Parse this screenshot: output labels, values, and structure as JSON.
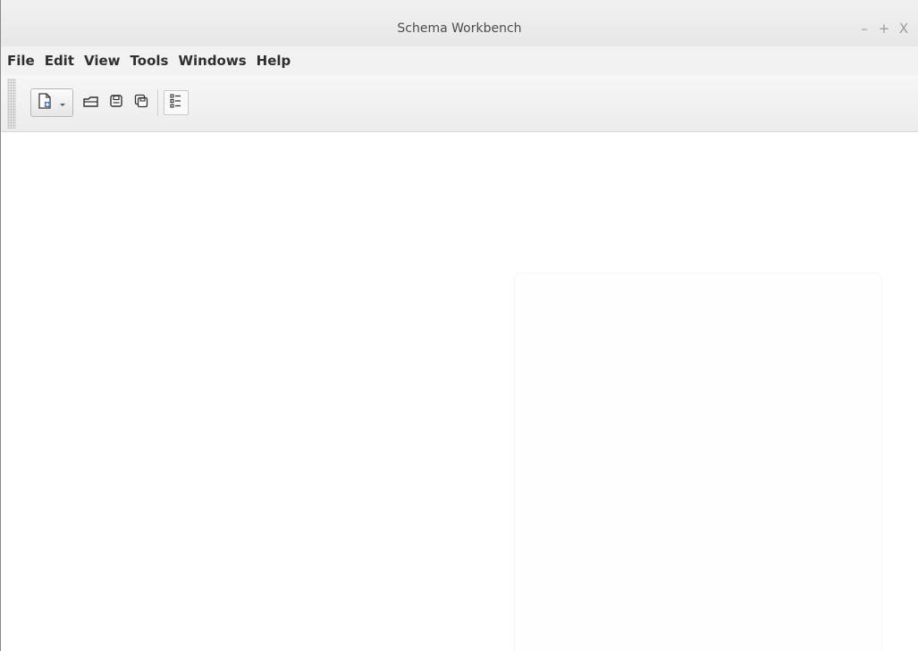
{
  "window": {
    "title": "Schema Workbench",
    "controls": {
      "minimize": "–",
      "maximize": "+",
      "close": "X"
    }
  },
  "menubar": {
    "items": [
      {
        "label": "File"
      },
      {
        "label": "Edit"
      },
      {
        "label": "View"
      },
      {
        "label": "Tools"
      },
      {
        "label": "Windows"
      },
      {
        "label": "Help"
      }
    ]
  },
  "toolbar": {
    "buttons": [
      {
        "icon": "new-file-icon"
      },
      {
        "icon": "dropdown-arrow-icon"
      },
      {
        "icon": "open-folder-icon"
      },
      {
        "icon": "save-icon"
      },
      {
        "icon": "save-as-icon"
      },
      {
        "icon": "preferences-icon"
      }
    ]
  },
  "colors": {
    "titlebar": "#ececec",
    "menubar": "#f2f2f2",
    "workspace": "#ffffff",
    "text": "#2f2f2f"
  }
}
